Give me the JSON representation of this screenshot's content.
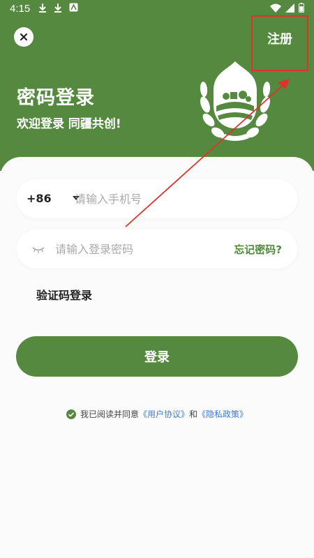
{
  "status_bar": {
    "time": "4:15",
    "left_icons": [
      "download-icon",
      "download-icon",
      "app-icon"
    ],
    "right_icons": [
      "wifi-icon",
      "signal-icon",
      "battery-icon"
    ]
  },
  "header": {
    "close_icon": "close-icon",
    "register_label": "注册",
    "title": "密码登录",
    "subtitle": "欢迎登录 同疆共创!"
  },
  "form": {
    "country_code": "+86",
    "phone_placeholder": "请输入手机号",
    "password_placeholder": "请输入登录密码",
    "forgot_password_label": "忘记密码?",
    "code_login_label": "验证码登录",
    "login_button_label": "登录"
  },
  "agreement": {
    "prefix": "我已阅读并同意",
    "user_agreement": "《用户协议》",
    "conjunction": "和",
    "privacy_policy": "《隐私政策》"
  },
  "colors": {
    "primary": "#55893f",
    "link": "#3e7bcf",
    "annotation_red": "#e0322d"
  }
}
